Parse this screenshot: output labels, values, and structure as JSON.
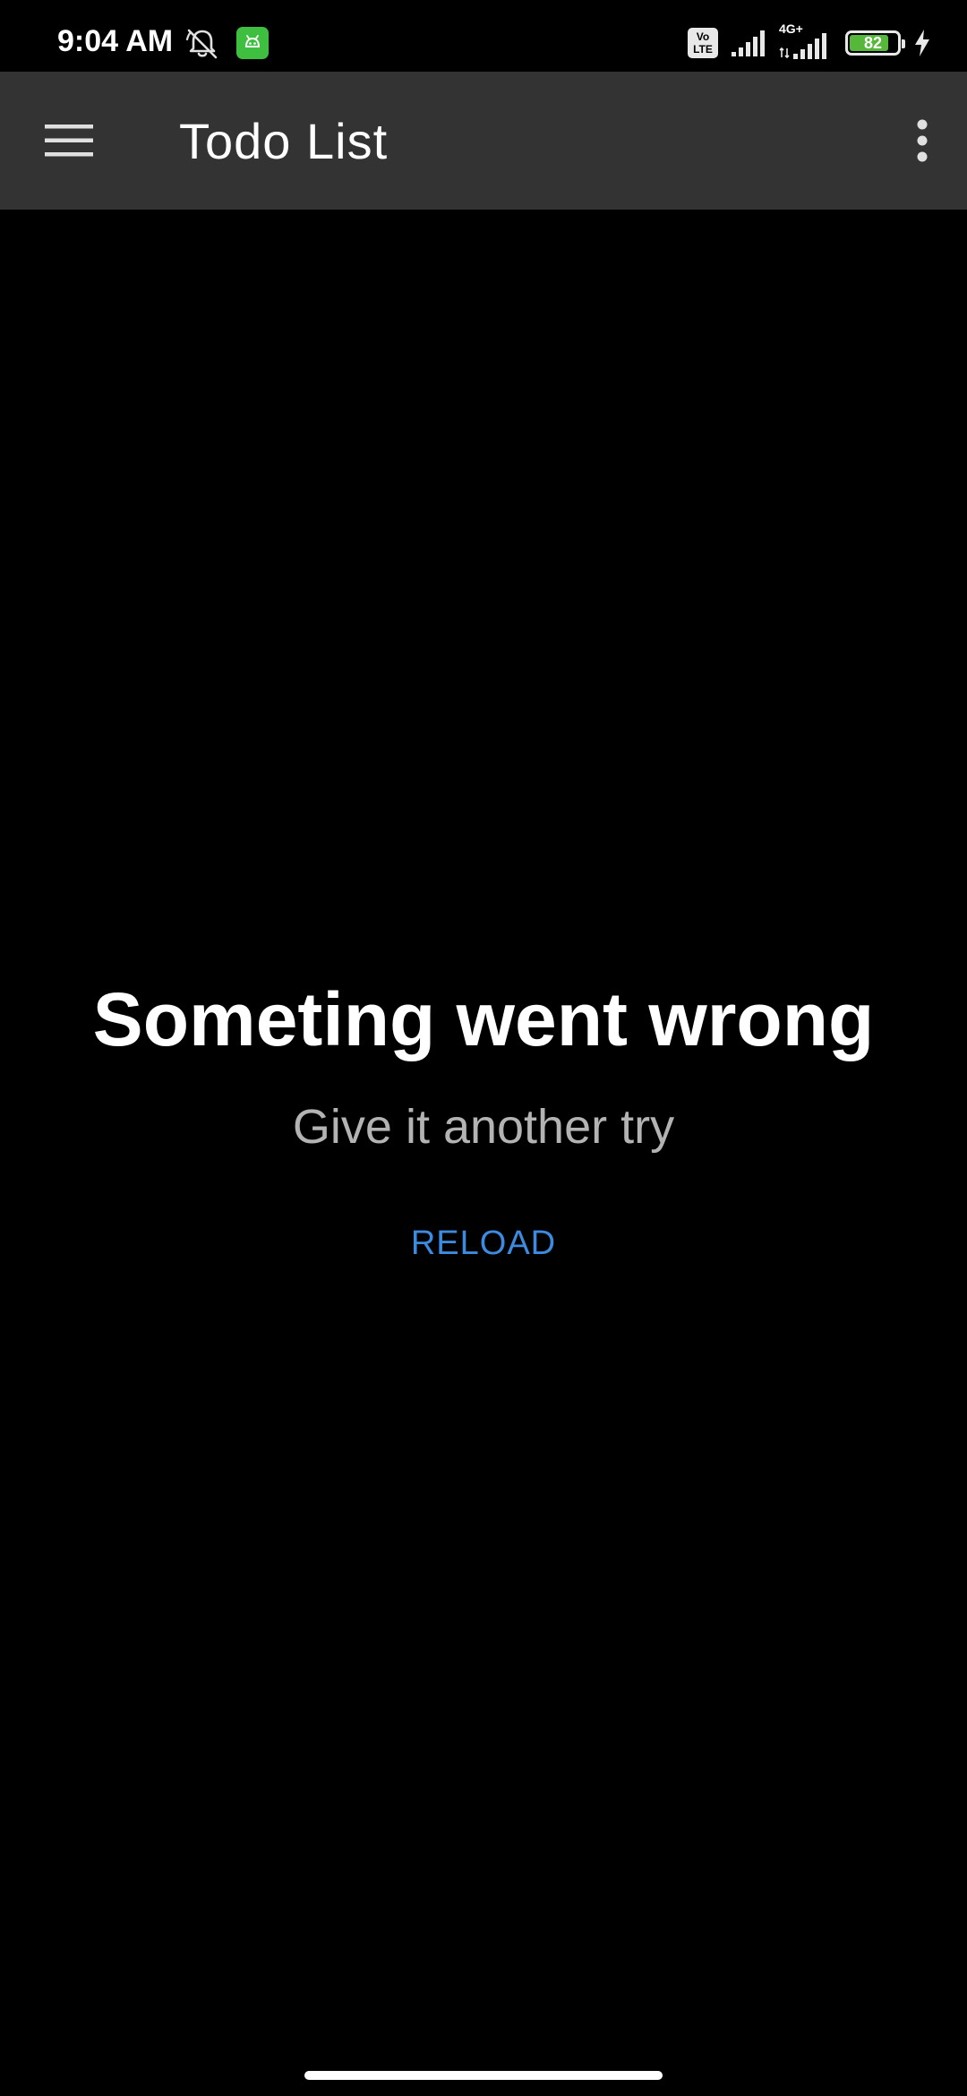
{
  "status_bar": {
    "time": "9:04 AM",
    "volte_top": "Vo",
    "volte_bottom": "LTE",
    "network_type": "4G+",
    "battery_level": "82",
    "battery_fraction": 0.82,
    "icons": [
      "bell-off-icon",
      "app-notification-icon",
      "volte-icon",
      "signal-icon",
      "signal-4g-icon",
      "battery-icon",
      "charging-icon"
    ]
  },
  "app_bar": {
    "title": "Todo List",
    "menu_icon": "hamburger-menu-icon",
    "overflow_icon": "more-vert-icon"
  },
  "error": {
    "title": "Someting went wrong",
    "subtitle": "Give it another try",
    "reload_label": "RELOAD"
  },
  "colors": {
    "background": "#000000",
    "app_bar": "#333333",
    "accent": "#3d8be0",
    "subtitle": "#b3b3b3",
    "battery_fill": "#56b83a",
    "notification_app": "#3fbf3f"
  }
}
